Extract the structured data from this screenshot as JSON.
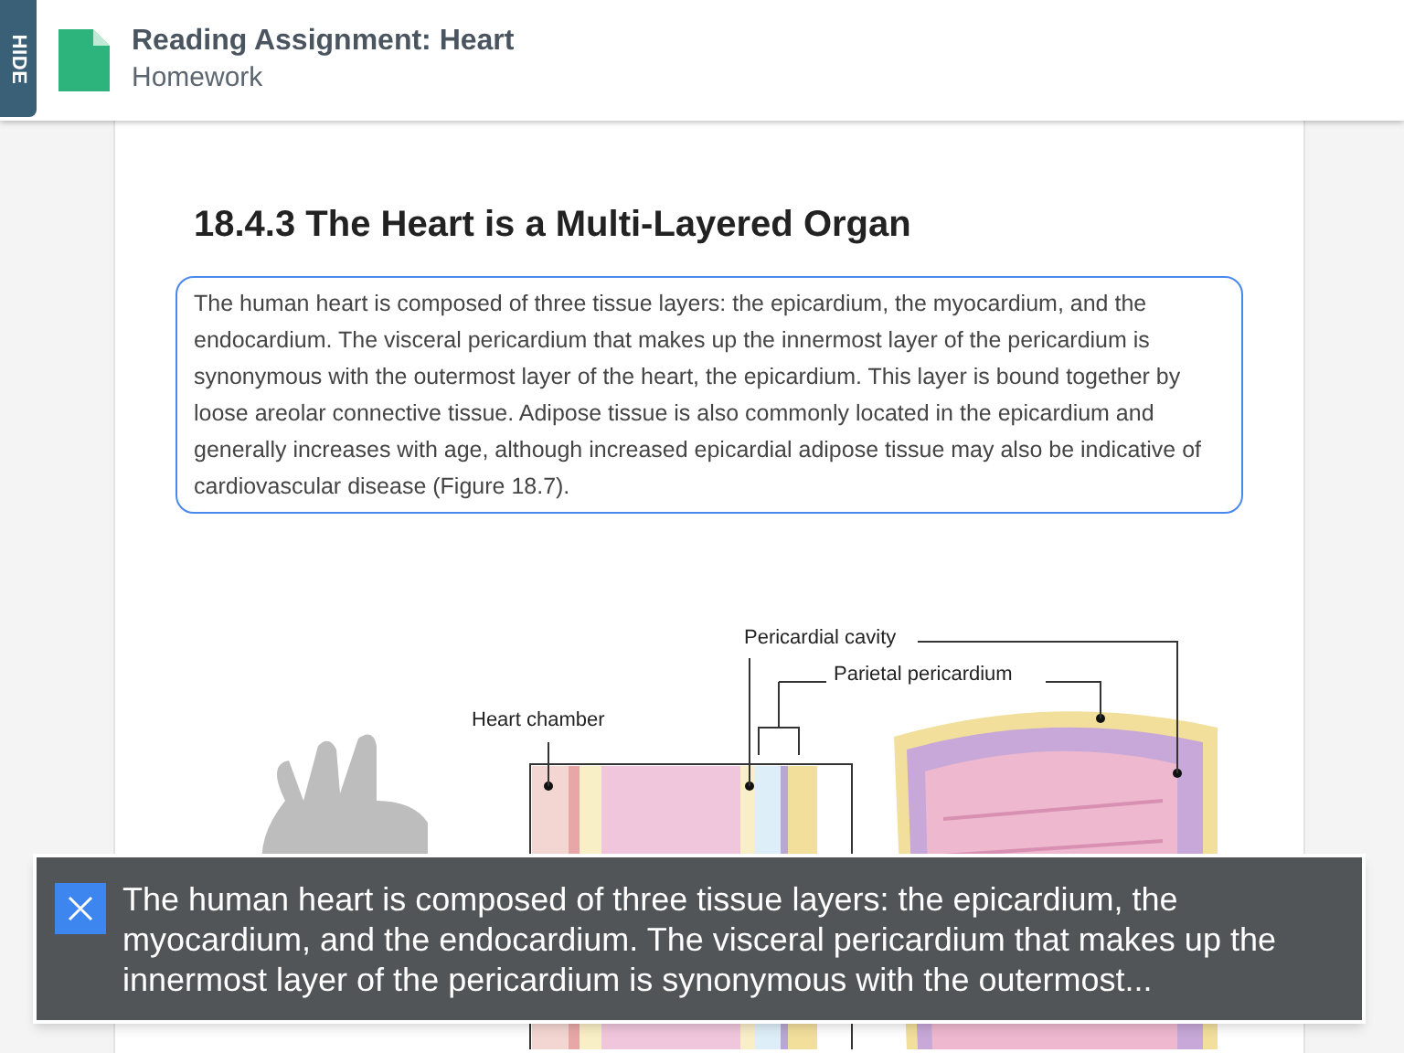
{
  "sidebar_toggle": {
    "label": "HIDE"
  },
  "header": {
    "title": "Reading Assignment: Heart",
    "subtitle": "Homework"
  },
  "section": {
    "heading": "18.4.3 The Heart is a Multi-Layered Organ",
    "paragraph": "The human heart is composed of three tissue layers: the epicardium, the myocardium, and the endocardium. The visceral pericardium that makes up the innermost layer of the pericardium is synonymous with the outermost layer of the heart, the epicardium. This layer is bound together by loose areolar connective tissue. Adipose tissue is also commonly located in the epicardium and generally increases with age, although increased epicardial adipose tissue may also be indicative of cardiovascular disease (Figure 18.7).",
    "paragraph_selected": true
  },
  "figure": {
    "labels": [
      "Pericardial cavity",
      "Parietal pericardium",
      "Heart chamber"
    ]
  },
  "caption": {
    "text": "The human heart is composed of three tissue layers: the epicardium, the myocardium, and the endocardium. The visceral pericardium that makes up the innermost layer of the pericardium is synonymous with the outermost..."
  }
}
